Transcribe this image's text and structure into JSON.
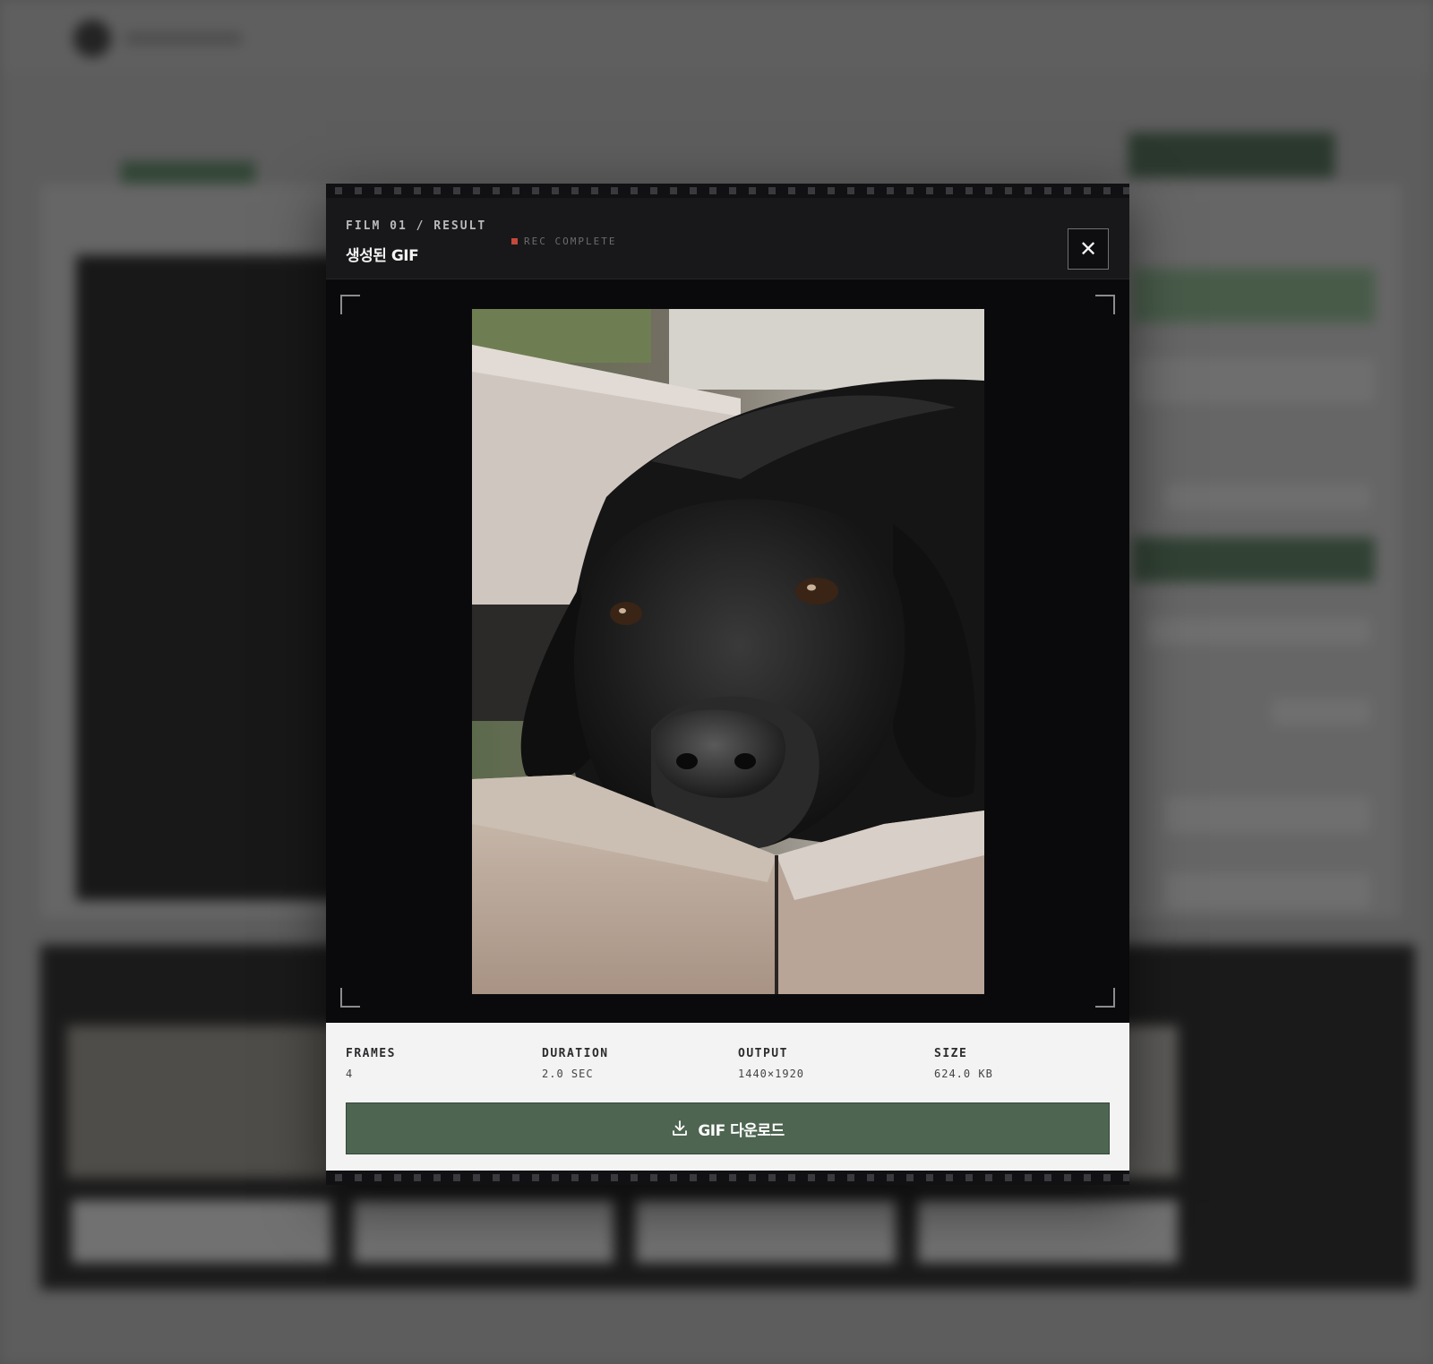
{
  "modal": {
    "film_label": "FILM 01 / RESULT",
    "title": "생성된 GIF",
    "rec_status": "REC COMPLETE",
    "close_icon": "close-icon",
    "close_glyph": "✕"
  },
  "preview": {
    "subject": "black-labrador-photo"
  },
  "stats": {
    "frames": {
      "label": "FRAMES",
      "value": "4"
    },
    "duration": {
      "label": "DURATION",
      "value": "2.0 SEC"
    },
    "output": {
      "label": "OUTPUT",
      "value": "1440×1920"
    },
    "size": {
      "label": "SIZE",
      "value": "624.0 KB"
    }
  },
  "download": {
    "icon": "download-icon",
    "label": "GIF 다운로드"
  },
  "colors": {
    "accent_green": "#4e6551",
    "rec_red": "#c5483a",
    "modal_dark": "#0a0a0c",
    "panel_light": "#f3f3f3"
  }
}
